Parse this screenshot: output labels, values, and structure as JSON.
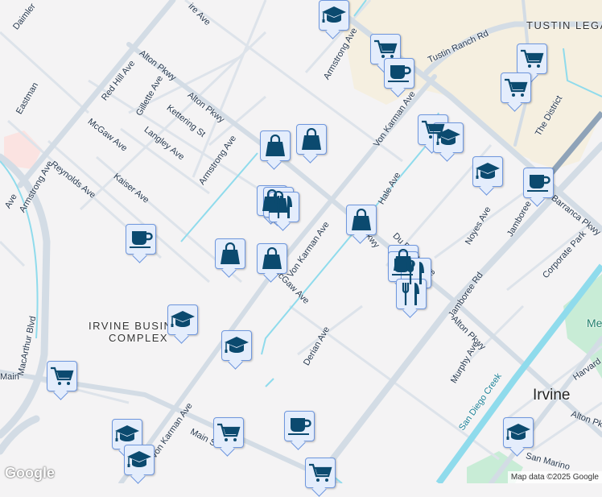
{
  "map": {
    "colors": {
      "background": "#f4f3f4",
      "major_road": "#d3dce5",
      "minor_road": "#dde3ea",
      "water": "#8fdbec",
      "commercial": "#f5efe0",
      "park": "#c8ecd6",
      "highway": "#8fa3b8",
      "pin_bg": "#e4edfc",
      "pin_border": "#6f97de",
      "pin_icon": "#0b4a6f"
    },
    "areas": [
      "TUSTIN LEGA",
      "IRVINE BUSINESS",
      "COMPLEX"
    ],
    "city": "Irvine",
    "water_label": "San Diego Creek",
    "park_label": "Me",
    "streets": [
      "Daimler",
      "Eastman",
      "Red Hill Ave",
      "Alton Pkwy",
      "Alton Pkwy",
      "Gillette Ave",
      "Kettering St",
      "McGaw Ave",
      "Langley Ave",
      "Armstrong Ave",
      "Reynolds Ave",
      "Kaiser Ave",
      "Armstrong Ave",
      "Armstrong Ave",
      "Von Karman Ave",
      "Tustin Ranch Rd",
      "The District",
      "Hale Ave",
      "Noyes Ave",
      "Jamboree",
      "Barranca Pkwy",
      "Von Karman Ave",
      "Alton Pkwy",
      "McGaw Ave",
      "Du Bridge Ave",
      "Corporate Park",
      "Jamboree Rd",
      "Alton Pkwy",
      "Derian Ave",
      "Murphy Ave",
      "Harvard",
      "MacArthur Blvd",
      "Von Karman Ave",
      "Main St",
      "Main",
      "Alton Pk",
      "San Marino",
      "ire Ave",
      "Ave"
    ],
    "markers": [
      "school",
      "shopping-cart",
      "coffee",
      "shopping-cart",
      "shopping-cart",
      "shopping-bag",
      "shopping-bag",
      "shopping-cart",
      "school",
      "school",
      "coffee",
      "shopping-bag",
      "shopping-bag",
      "restaurant",
      "shopping-bag",
      "coffee",
      "shopping-bag",
      "shopping-bag",
      "shopping-bag",
      "coffee",
      "restaurant",
      "restaurant",
      "school",
      "school",
      "shopping-cart",
      "coffee",
      "school",
      "shopping-cart",
      "school",
      "shopping-cart",
      "school"
    ],
    "logo": "Google",
    "attribution": "Map data ©2025 Google"
  }
}
